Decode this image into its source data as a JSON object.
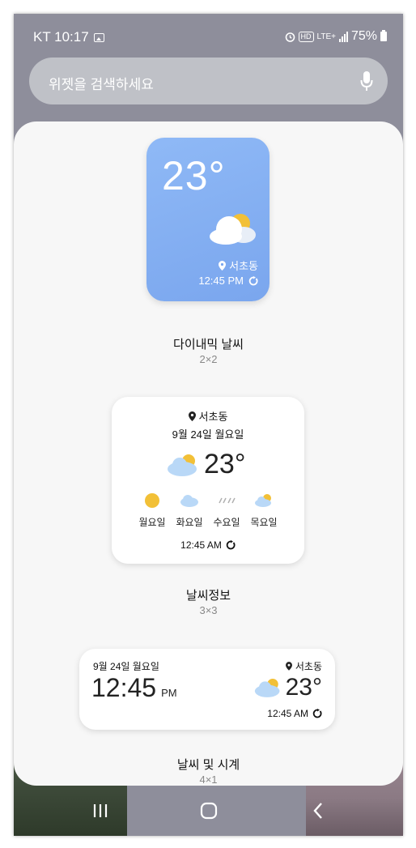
{
  "status": {
    "carrier_time": "KT 10:17",
    "hd": "HD",
    "lte": "LTE+",
    "battery": "75%"
  },
  "search": {
    "placeholder": "위젯을 검색하세요"
  },
  "widgets": [
    {
      "temp": "23°",
      "location": "서초동",
      "time": "12:45 PM",
      "label": "다이내믹 날씨",
      "size": "2×2"
    },
    {
      "location": "서초동",
      "date": "9월 24일 월요일",
      "temp": "23°",
      "days": [
        "월요일",
        "화요일",
        "수요일",
        "목요일"
      ],
      "time": "12:45 AM",
      "label": "날씨정보",
      "size": "3×3"
    },
    {
      "date": "9월 24일 월요일",
      "clock": "12:45",
      "ampm": "PM",
      "location": "서초동",
      "temp": "23°",
      "time": "12:45 AM",
      "label": "날씨 및 시계",
      "size": "4×1"
    }
  ],
  "colors": {
    "sun": "#f2c037",
    "cloud_light": "#cde4fb",
    "widget_blue": "#7aa6ee"
  },
  "icons": [
    "picture-icon",
    "alarm-icon",
    "signal-icon",
    "battery-icon",
    "mic-icon",
    "location-pin-icon",
    "refresh-icon",
    "partly-cloudy-icon",
    "sun-icon",
    "cloud-icon",
    "rain-icon",
    "recents-icon",
    "home-icon",
    "back-icon"
  ]
}
